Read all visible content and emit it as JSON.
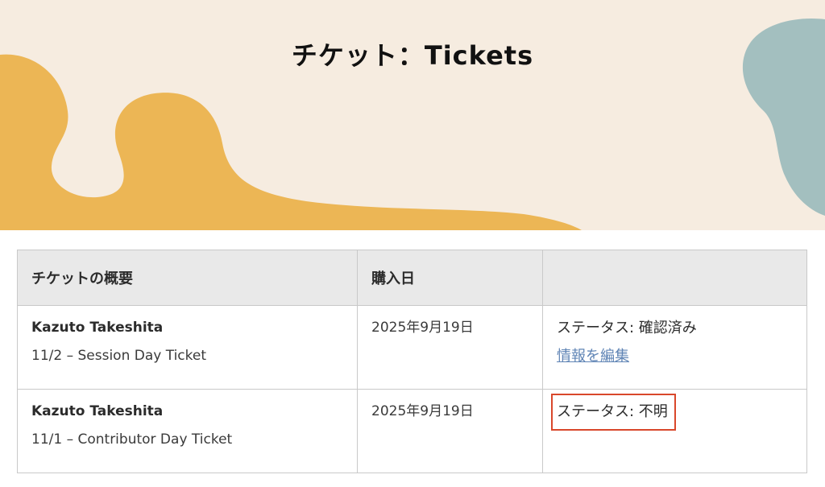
{
  "page": {
    "title": "チケット：Tickets"
  },
  "colors": {
    "hero_background": "#f6ece0",
    "blob_orange": "#ecb655",
    "blob_teal": "#a3bfbf",
    "header_row": "#e9e9e9",
    "link": "#5f84b5",
    "highlight_border": "#d9472b"
  },
  "table": {
    "headers": {
      "summary": "チケットの概要",
      "purchase_date": "購入日",
      "status": ""
    },
    "rows": [
      {
        "attendee": "Kazuto Takeshita",
        "ticket": "11/2 – Session Day Ticket",
        "purchase_date": "2025年9月19日",
        "status": "ステータス: 確認済み",
        "action_link": "情報を編集"
      },
      {
        "attendee": "Kazuto Takeshita",
        "ticket": "11/1 – Contributor Day Ticket",
        "purchase_date": "2025年9月19日",
        "status": "ステータス: 不明",
        "highlighted": true
      }
    ]
  }
}
